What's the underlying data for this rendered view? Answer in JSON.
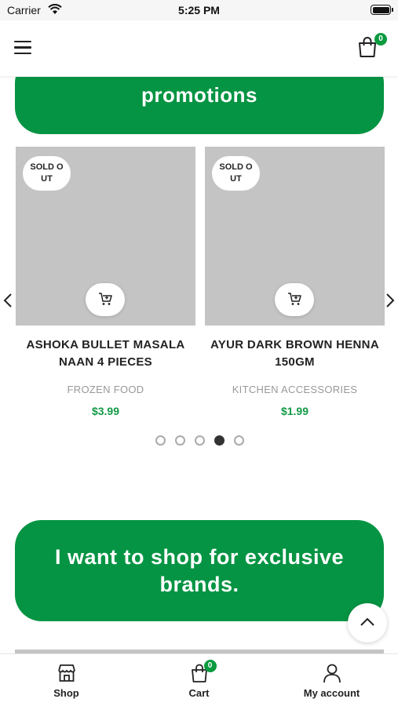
{
  "status_bar": {
    "carrier": "Carrier",
    "time": "5:25 PM"
  },
  "header": {
    "cart_count": "0"
  },
  "banner_top": {
    "visible_text": "promotions"
  },
  "products": [
    {
      "sold_label": "SOLD O\nUT",
      "name": "ASHOKA BULLET MASALA NAAN 4 PIECES",
      "category": "FROZEN FOOD",
      "price": "$3.99"
    },
    {
      "sold_label": "SOLD O\nUT",
      "name": "AYUR DARK BROWN HENNA 150GM",
      "category": "KITCHEN ACCESSORIES",
      "price": "$1.99"
    }
  ],
  "pager": {
    "count": 5,
    "active_index": 3
  },
  "banner_bottom": {
    "text": "I want to shop for exclusive brands."
  },
  "bottom_nav": {
    "shop_label": "Shop",
    "cart_label": "Cart",
    "cart_count": "0",
    "account_label": "My account"
  },
  "colors": {
    "brand_green": "#059443",
    "price_green": "#119a45",
    "placeholder_grey": "#c4c4c4"
  },
  "icons": [
    "wifi-icon",
    "battery-icon",
    "menu-icon",
    "shopping-bag-icon",
    "cart-icon",
    "chevron-left-icon",
    "chevron-right-icon",
    "chevron-up-icon",
    "store-icon",
    "user-icon"
  ]
}
